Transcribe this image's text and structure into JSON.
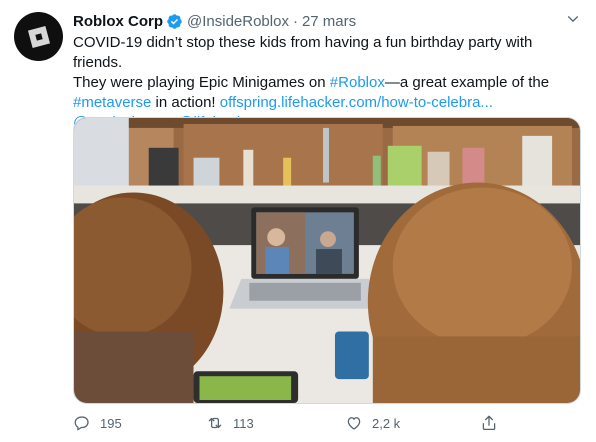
{
  "tweet": {
    "author": {
      "display_name": "Roblox Corp",
      "handle": "@InsideRoblox",
      "verified": true,
      "avatar_icon": "roblox-logo"
    },
    "separator": "·",
    "time": "27 mars",
    "text": {
      "line1": "COVID-19 didn’t stop these kids from having a fun birthday party with friends.",
      "line2_before": "They were playing Epic Minigames on ",
      "hashtag_roblox": "#Roblox",
      "line2_after": "—a great example of the",
      "hashtag_metaverse": "#metaverse",
      "line3_mid": " in action! ",
      "url": "offspring.lifehacker.com/how-to-celebra...",
      "mention1": "@TypicalRBLX",
      "mention2": "@lifehacker"
    },
    "media": {
      "description_icon": "photo-kids-video-call"
    },
    "actions": {
      "replies": "195",
      "retweets": "113",
      "likes": "2,2 k"
    },
    "colors": {
      "link": "#1d9bf0",
      "verified": "#1d9bf0",
      "secondary_text": "#536471"
    }
  }
}
